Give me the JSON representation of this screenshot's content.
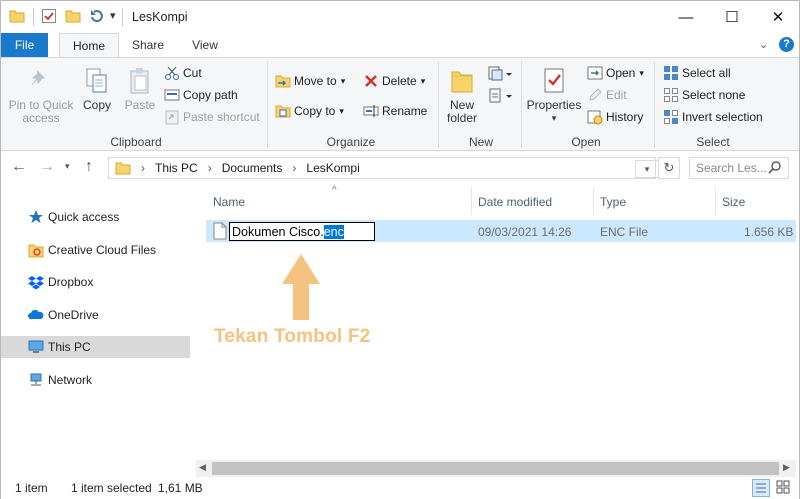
{
  "window": {
    "title": "LesKompi",
    "controls": {
      "minimize": "—",
      "maximize": "☐",
      "close": "✕"
    }
  },
  "qat": {
    "dropdown": "▾"
  },
  "tabs": [
    {
      "label": "File"
    },
    {
      "label": "Home"
    },
    {
      "label": "Share"
    },
    {
      "label": "View"
    }
  ],
  "ribbon": {
    "clipboard": {
      "group": "Clipboard",
      "pin_line1": "Pin to Quick",
      "pin_line2": "access",
      "copy": "Copy",
      "paste": "Paste",
      "cut": "Cut",
      "copy_path": "Copy path",
      "paste_shortcut": "Paste shortcut"
    },
    "organize": {
      "group": "Organize",
      "move_to": "Move to",
      "copy_to": "Copy to",
      "delete": "Delete",
      "rename": "Rename"
    },
    "new": {
      "group": "New",
      "new_folder_line1": "New",
      "new_folder_line2": "folder"
    },
    "open": {
      "group": "Open",
      "properties": "Properties",
      "open": "Open",
      "edit": "Edit",
      "history": "History"
    },
    "select": {
      "group": "Select",
      "select_all": "Select all",
      "select_none": "Select none",
      "invert": "Invert selection"
    }
  },
  "address": {
    "crumbs": [
      "This PC",
      "Documents",
      "LesKompi"
    ],
    "search_placeholder": "Search Les..."
  },
  "nav": [
    {
      "label": "Quick access"
    },
    {
      "label": "Creative Cloud Files"
    },
    {
      "label": "Dropbox"
    },
    {
      "label": "OneDrive"
    },
    {
      "label": "This PC"
    },
    {
      "label": "Network"
    }
  ],
  "columns": {
    "name": "Name",
    "date": "Date modified",
    "type": "Type",
    "size": "Size"
  },
  "file": {
    "name_base": "Dokumen Cisco.",
    "name_ext": "enc",
    "date": "09/03/2021 14:26",
    "type": "ENC File",
    "size": "1.656 KB"
  },
  "annotation": "Tekan Tombol F2",
  "status": {
    "count": "1 item",
    "selected": "1 item selected",
    "size": "1,61 MB"
  },
  "colors": {
    "file_tab": "#1979ca",
    "selection": "#cce8ff",
    "annotation": "#f3c37f",
    "rename_highlight": "#0078d7"
  }
}
